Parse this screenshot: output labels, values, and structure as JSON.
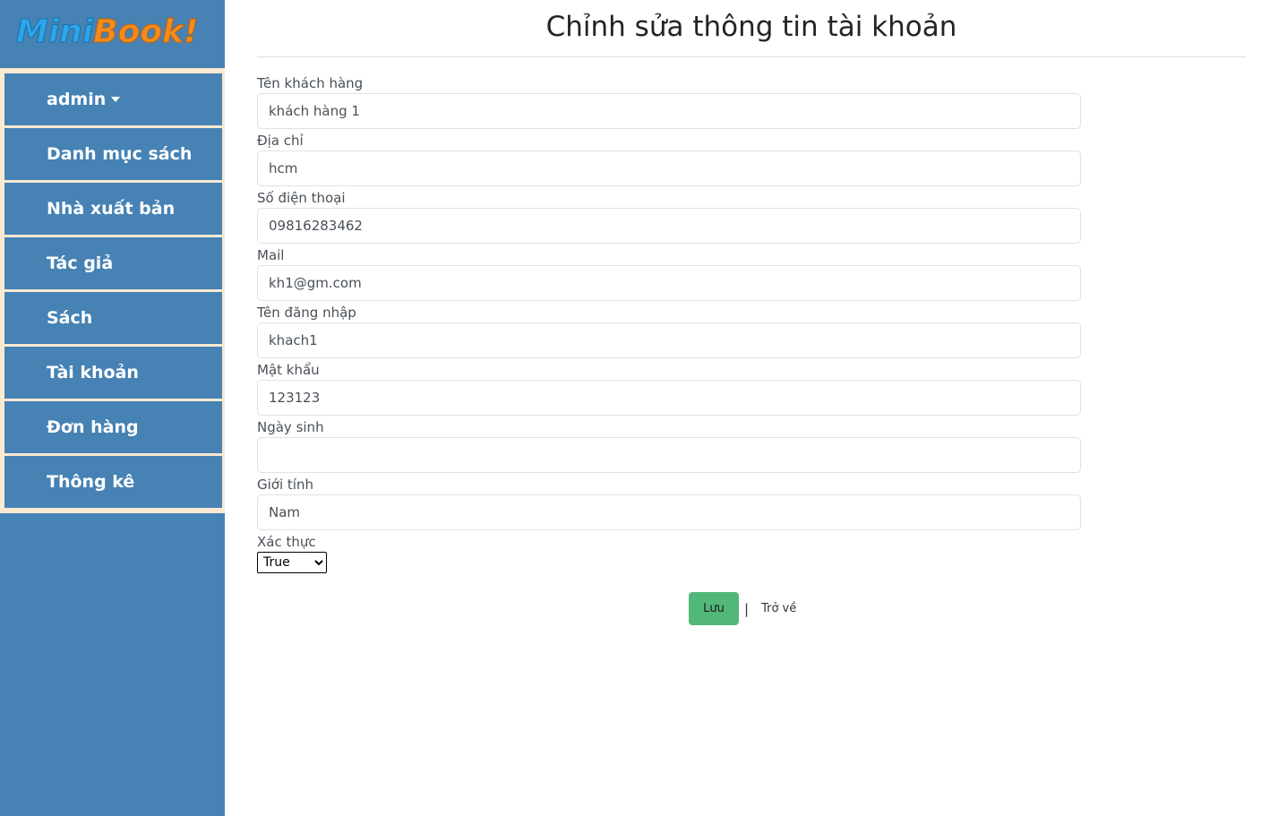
{
  "brand": {
    "logo_part1": "Mini",
    "logo_part2": "Book!"
  },
  "sidebar": {
    "items": [
      {
        "label": "admin",
        "has_caret": true
      },
      {
        "label": "Danh mục sách"
      },
      {
        "label": "Nhà xuất bản"
      },
      {
        "label": "Tác giả"
      },
      {
        "label": "Sách"
      },
      {
        "label": "Tài khoản"
      },
      {
        "label": "Đơn hàng"
      },
      {
        "label": "Thông kê"
      }
    ]
  },
  "page": {
    "title": "Chỉnh sửa thông tin tài khoản"
  },
  "form": {
    "fields": [
      {
        "label": "Tên khách hàng",
        "value": "khách hàng 1"
      },
      {
        "label": "Địa chỉ",
        "value": "hcm"
      },
      {
        "label": "Số điện thoại",
        "value": "09816283462"
      },
      {
        "label": "Mail",
        "value": "kh1@gm.com"
      },
      {
        "label": "Tên đăng nhập",
        "value": "khach1"
      },
      {
        "label": "Mật khẩu",
        "value": "123123"
      },
      {
        "label": "Ngày sinh",
        "value": ""
      },
      {
        "label": "Giới tính",
        "value": "Nam"
      }
    ],
    "verified": {
      "label": "Xác thực",
      "selected": "True"
    }
  },
  "actions": {
    "save_label": "Lưu",
    "separator": "|",
    "back_label": "Trở về"
  },
  "colors": {
    "sidebar_bg": "#4682b4",
    "nav_border": "#fbe9d2",
    "save_button": "#52b87a"
  }
}
